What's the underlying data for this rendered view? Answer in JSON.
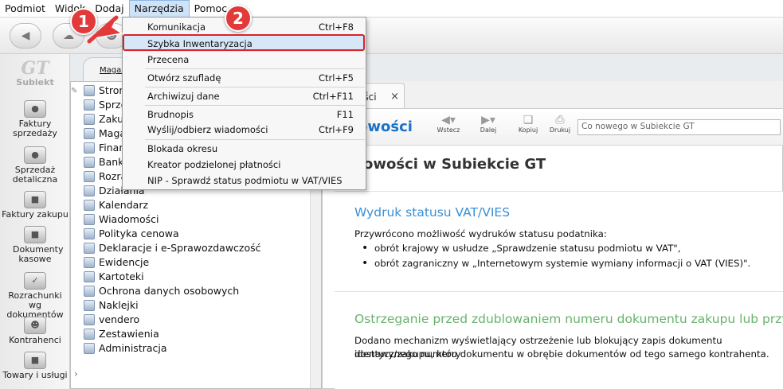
{
  "menubar": {
    "items": [
      {
        "label": "Podmiot"
      },
      {
        "label": "Widok"
      },
      {
        "label": "Dodaj"
      },
      {
        "label": "Narzędzia"
      },
      {
        "label": "Pomoc"
      }
    ]
  },
  "sidebar": {
    "logo_mark": "GT",
    "logo_text": "Subiekt",
    "items": [
      {
        "label": "Faktury sprzedaży"
      },
      {
        "label": "Sprzedaż detaliczna"
      },
      {
        "label": "Faktury zakupu"
      },
      {
        "label": "Dokumenty kasowe"
      },
      {
        "label": "Rozrachunki wg dokumentów"
      },
      {
        "label": "Kontrahenci"
      },
      {
        "label": "Towary i usługi"
      }
    ]
  },
  "module_tab": {
    "label": "Magaz"
  },
  "tree": {
    "items": [
      {
        "label": "Strona"
      },
      {
        "label": "Sprzedaż"
      },
      {
        "label": "Zakupy"
      },
      {
        "label": "Magazyn"
      },
      {
        "label": "Finanse"
      },
      {
        "label": "Bank"
      },
      {
        "label": "Rozrachunki"
      },
      {
        "label": "Działania"
      },
      {
        "label": "Kalendarz"
      },
      {
        "label": "Wiadomości"
      },
      {
        "label": "Polityka cenowa"
      },
      {
        "label": "Deklaracje i e-Sprawozdawczość"
      },
      {
        "label": "Ewidencje"
      },
      {
        "label": "Kartoteki"
      },
      {
        "label": "Ochrona danych osobowych"
      },
      {
        "label": "Naklejki"
      },
      {
        "label": "vendero"
      },
      {
        "label": "Zestawienia"
      },
      {
        "label": "Administracja"
      }
    ]
  },
  "doc_tab": {
    "label": "ości",
    "close": "×"
  },
  "doc_header": {
    "title": "owości",
    "back": "Wstecz",
    "forward": "Dalej",
    "copy": "Kopiuj",
    "print": "Drukuj",
    "search_placeholder": "Co nowego w Subiekcie GT"
  },
  "news": {
    "page_title": "owości w Subiekcie GT",
    "sections": [
      {
        "heading": "Wydruk statusu VAT/VIES",
        "heading_color": "#3a8fd6",
        "text": "Przywrócono możliwość wydruków statusu podatnika:",
        "bullets": [
          "obrót krajowy w usłudze „Sprawdzenie statusu podmiotu w VAT\",",
          "obrót zagraniczny w „Internetowym systemie wymiany informacji o VAT (VIES)\"."
        ]
      },
      {
        "heading": "Ostrzeganie przed zdublowaniem numeru dokumentu zakupu lub przyjęcia",
        "heading_color": "#67b36a",
        "text_lines": [
          "Dodano mechanizm wyświetlający ostrzeżenie lub blokujący zapis dokumentu dostawy/zakupu, który",
          "identycznego numeru dokumentu w obrębie dokumentów od tego samego kontrahenta."
        ]
      }
    ]
  },
  "dropdown": {
    "items": [
      {
        "label": "Komunikacja",
        "shortcut": "Ctrl+F8"
      },
      {
        "label": "Szybka Inwentaryzacja",
        "shortcut": ""
      },
      {
        "label": "Przecena",
        "shortcut": ""
      },
      {
        "label": "Otwórz szufladę",
        "shortcut": "Ctrl+F5"
      },
      {
        "label": "Archiwizuj dane",
        "shortcut": "Ctrl+F11"
      },
      {
        "label": "Brudnopis",
        "shortcut": "F11"
      },
      {
        "label": "Wyślij/odbierz wiadomości",
        "shortcut": "Ctrl+F9"
      },
      {
        "label": "Blokada okresu",
        "shortcut": ""
      },
      {
        "label": "Kreator podzielonej płatności",
        "shortcut": ""
      },
      {
        "label": "NIP - Sprawdź status podmiotu w VAT/VIES",
        "shortcut": ""
      }
    ]
  },
  "markers": {
    "one": "1",
    "two": "2"
  },
  "colors": {
    "accent": "#1a72c9",
    "marker": "#e23a3a",
    "highlight_border": "#d8232a"
  }
}
